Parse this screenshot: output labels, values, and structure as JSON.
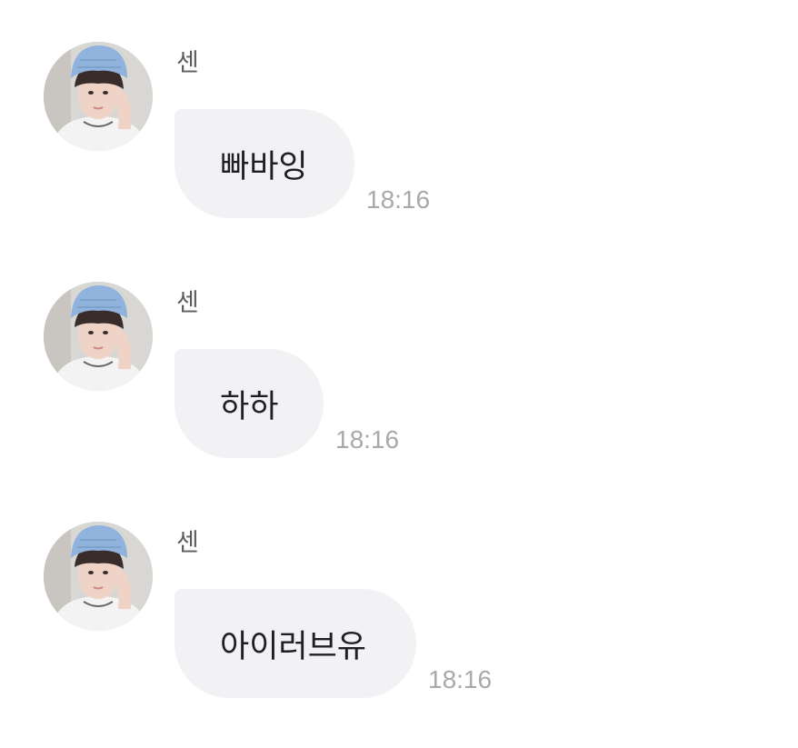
{
  "messages": [
    {
      "sender": "센",
      "text": "빠바잉",
      "time": "18:16"
    },
    {
      "sender": "센",
      "text": "하하",
      "time": "18:16"
    },
    {
      "sender": "센",
      "text": "아이러브유",
      "time": "18:16"
    }
  ],
  "avatar": {
    "icon": "profile-photo",
    "beanie_color": "#8fb3dc",
    "shirt_color": "#f3f3f3",
    "skin_color": "#efd3c6",
    "hair_color": "#3a2c2a"
  }
}
